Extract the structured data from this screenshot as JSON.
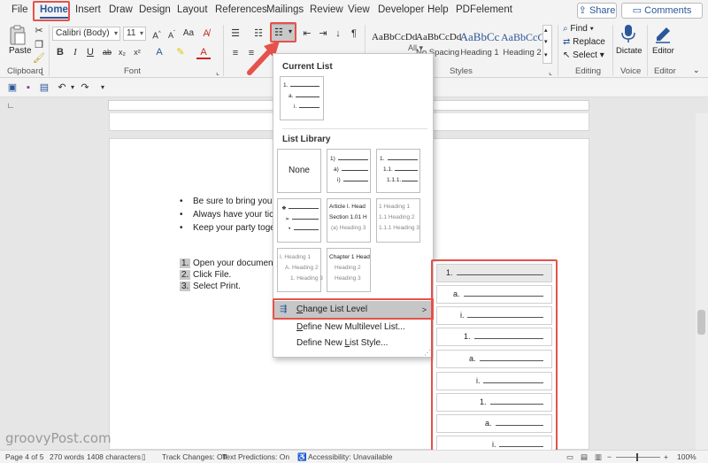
{
  "menubar": {
    "tabs": [
      "File",
      "Home",
      "Insert",
      "Draw",
      "Design",
      "Layout",
      "References",
      "Mailings",
      "Review",
      "View",
      "Developer",
      "Help",
      "PDFelement"
    ],
    "share": "Share",
    "comments": "Comments"
  },
  "ribbon": {
    "paste": "Paste",
    "font_name": "Calibri (Body)",
    "font_size": "11",
    "groups": {
      "clipboard": "Clipboard",
      "font": "Font",
      "styles": "Styles",
      "editing": "Editing",
      "voice": "Voice",
      "editor": "Editor"
    },
    "all_label": "All",
    "styles": [
      {
        "sample": "AaBbCcDd",
        "name": ""
      },
      {
        "sample": "AaBbCcDd",
        "name": "No Spacing"
      },
      {
        "sample": "AaBbCc",
        "name": "Heading 1"
      },
      {
        "sample": "AaBbCcC",
        "name": "Heading 2"
      }
    ],
    "find": "Find",
    "replace": "Replace",
    "select": "Select",
    "dictate": "Dictate",
    "editor": "Editor"
  },
  "document": {
    "bullets": [
      "Be sure to bring your d",
      "Always have your ticke",
      "Keep your party togeth"
    ],
    "numbered": [
      {
        "n": "1.",
        "text": "Open your document."
      },
      {
        "n": "2.",
        "text": "Click File."
      },
      {
        "n": "3.",
        "text": "Select Print."
      }
    ]
  },
  "dropdown": {
    "current_list": "Current List",
    "list_library": "List Library",
    "none": "None",
    "tiles": {
      "t2": [
        "1)",
        "a)",
        "i)"
      ],
      "t3": [
        "1.",
        "1.1.",
        "1.1.1."
      ],
      "t5": [
        "Article I. Head",
        "Section 1.01 H",
        "(a) Heading 3"
      ],
      "t6": [
        "1 Heading 1",
        "1.1 Heading 2",
        "1.1.1 Heading 3"
      ],
      "t7": [
        "I. Heading 1",
        "A. Heading 2",
        "1. Heading 3"
      ],
      "t8": [
        "Chapter 1 Head",
        "Heading 2",
        "Heading 3"
      ],
      "current": [
        "1.",
        "a.",
        "i."
      ]
    },
    "change_level_pre": "",
    "change_level_u": "C",
    "change_level_post": "hange List Level",
    "define_multi_u": "D",
    "define_multi_post": "efine New Multilevel List...",
    "define_style_pre": "Define New ",
    "define_style_u": "L",
    "define_style_post": "ist Style..."
  },
  "submenu": {
    "levels": [
      "1.",
      "a.",
      "i.",
      "1.",
      "a.",
      "i.",
      "1.",
      "a.",
      "i."
    ]
  },
  "statusbar": {
    "page": "Page 4 of 5",
    "words": "270 words",
    "chars": "1408 characters",
    "track": "Track Changes: Off",
    "predict": "Text Predictions: On",
    "access": "Accessibility: Unavailable",
    "zoom": "100%"
  },
  "watermark": "groovyPost.com",
  "colors": {
    "accent": "#2b579a",
    "highlight": "#e5524b"
  }
}
